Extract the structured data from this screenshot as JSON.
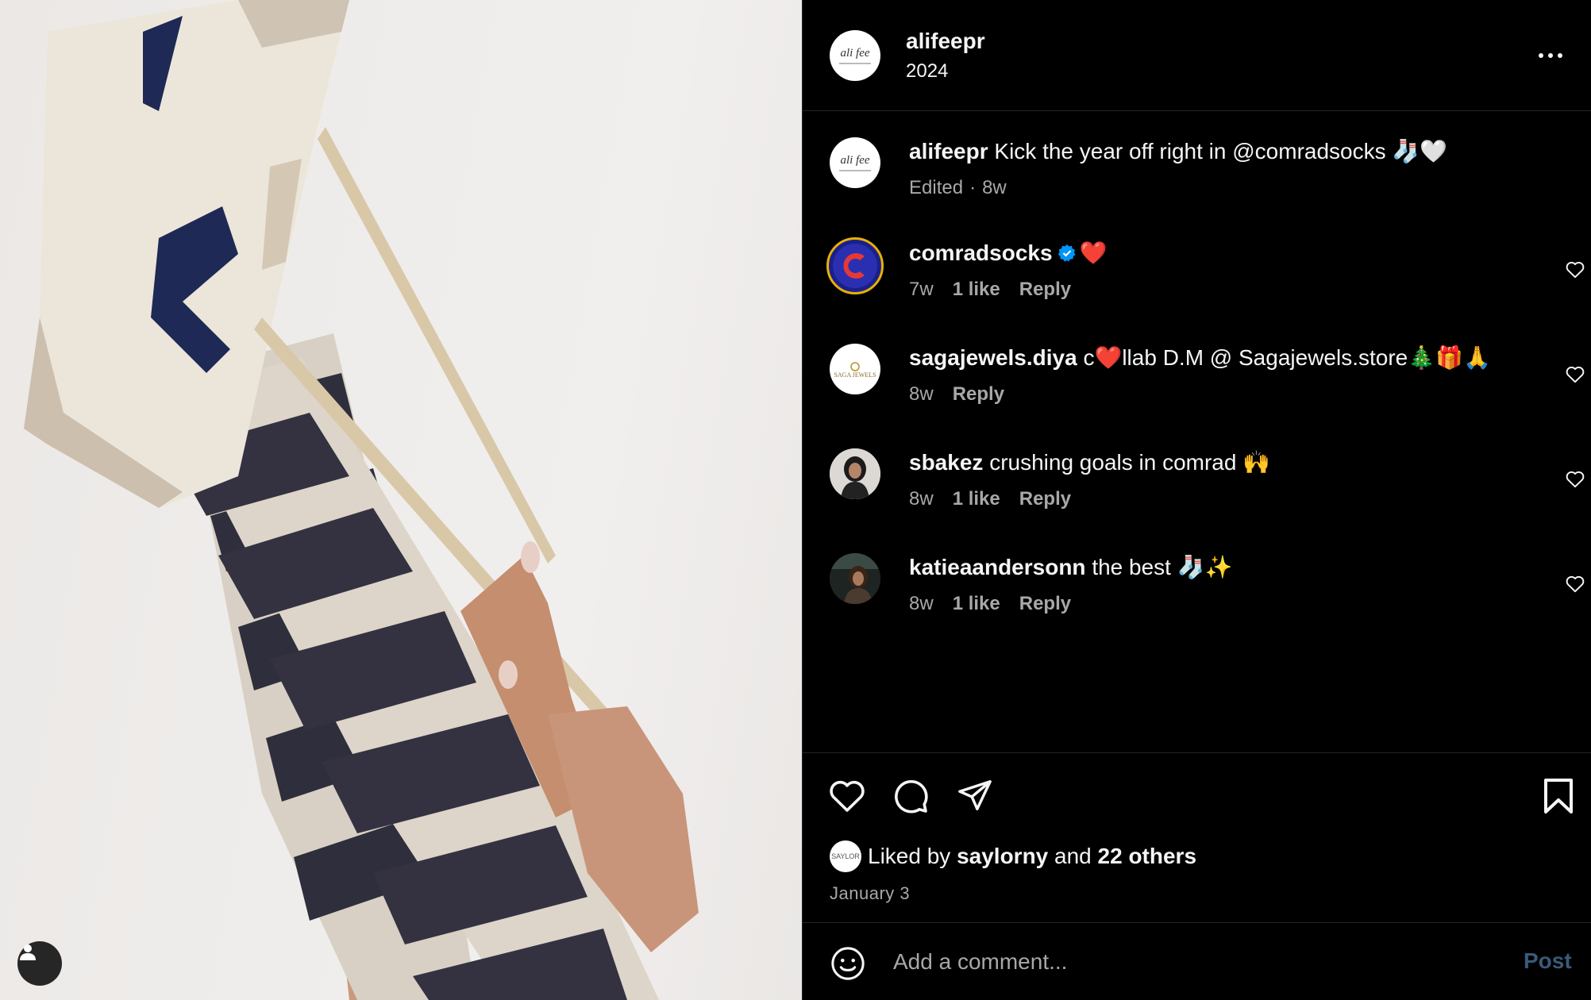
{
  "post": {
    "username": "alifeepr",
    "subtitle": "2024",
    "avatar_text": "ali fee",
    "caption": {
      "username": "alifeepr",
      "text": "Kick the year off right in @comradsocks 🧦🤍",
      "edited_label": "Edited",
      "time": "8w"
    },
    "comments": [
      {
        "username": "comradsocks",
        "verified": true,
        "text": "❤️",
        "time": "7w",
        "likes": "1 like",
        "reply": "Reply",
        "avatar": "C"
      },
      {
        "username": "sagajewels.diya",
        "verified": false,
        "text": "c❤️llab D.M @ Sagajewels.store🎄🎁🙏",
        "time": "8w",
        "likes": "",
        "reply": "Reply",
        "avatar": "SAGA JEWELS"
      },
      {
        "username": "sbakez",
        "verified": false,
        "text": "crushing goals in comrad 🙌",
        "time": "8w",
        "likes": "1 like",
        "reply": "Reply",
        "avatar": ""
      },
      {
        "username": "katieaandersonn",
        "verified": false,
        "text": "the best 🧦✨",
        "time": "8w",
        "likes": "1 like",
        "reply": "Reply",
        "avatar": ""
      }
    ],
    "liked_by": {
      "prefix": "Liked by",
      "user": "saylorny",
      "conj": "and",
      "others": "22 others",
      "avatar_text": "SAYLOR"
    },
    "date": "January 3",
    "comment_input": {
      "placeholder": "Add a comment...",
      "post_label": "Post"
    }
  },
  "icons": {
    "more": "more-options-icon",
    "like": "heart-icon",
    "comment": "comment-icon",
    "share": "share-icon",
    "save": "bookmark-icon",
    "emoji": "emoji-icon",
    "tags": "user-tag-icon"
  },
  "colors": {
    "background": "#000000",
    "text": "#f5f5f5",
    "muted": "#a8a8a8",
    "divider": "#262626",
    "verified": "#0095f6",
    "post_disabled": "#3a5a7a"
  }
}
